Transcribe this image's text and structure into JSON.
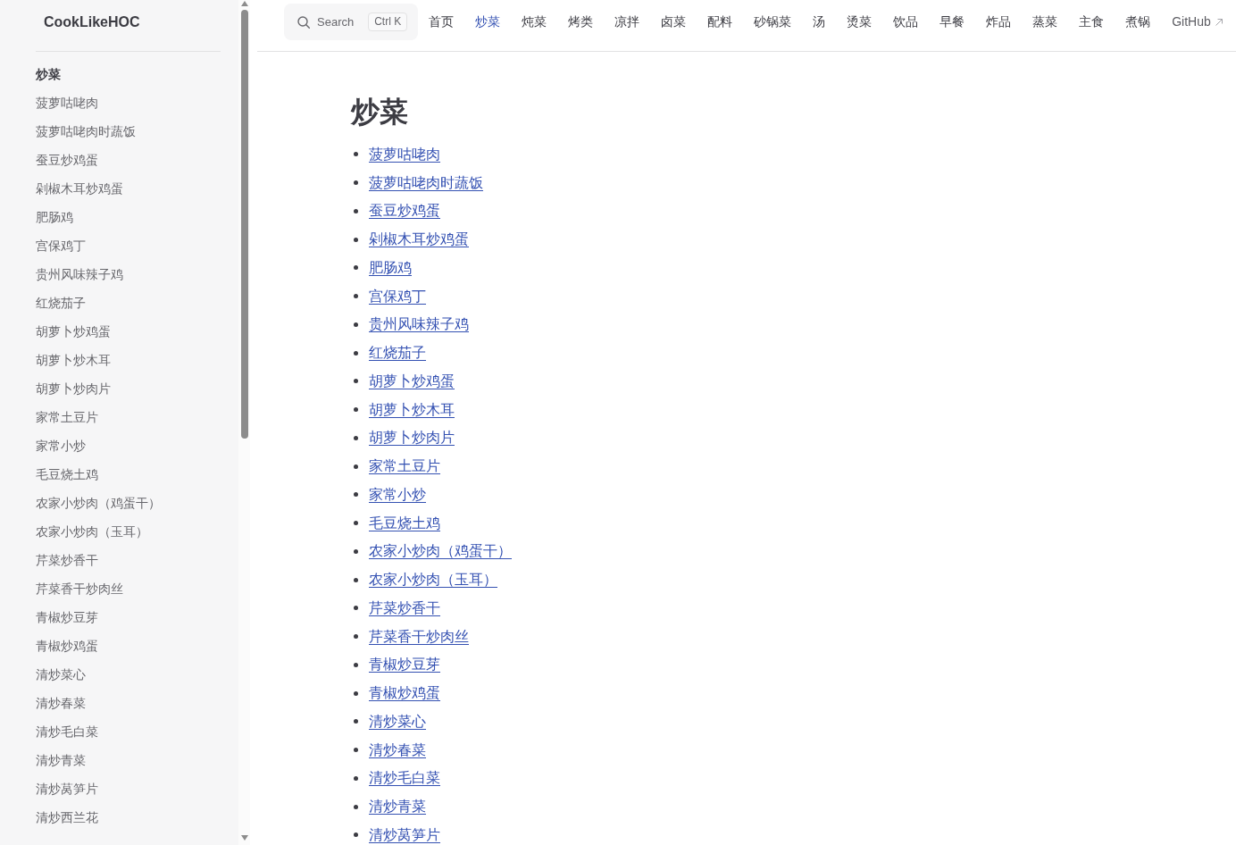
{
  "sidebar": {
    "logo": "CookLikeHOC",
    "group": {
      "title": "炒菜",
      "items": [
        {
          "label": "菠萝咕咾肉",
          "selected": false
        },
        {
          "label": "菠萝咕咾肉时蔬饭",
          "selected": false
        },
        {
          "label": "蚕豆炒鸡蛋",
          "selected": false
        },
        {
          "label": "剁椒木耳炒鸡蛋",
          "selected": false
        },
        {
          "label": "肥肠鸡",
          "selected": false
        },
        {
          "label": "宫保鸡丁",
          "selected": false
        },
        {
          "label": "贵州风味辣子鸡",
          "selected": false
        },
        {
          "label": "红烧茄子",
          "selected": false
        },
        {
          "label": "胡萝卜炒鸡蛋",
          "selected": false
        },
        {
          "label": "胡萝卜炒木耳",
          "selected": false
        },
        {
          "label": "胡萝卜炒肉片",
          "selected": false
        },
        {
          "label": "家常土豆片",
          "selected": false
        },
        {
          "label": "家常小炒",
          "selected": false
        },
        {
          "label": "毛豆烧土鸡",
          "selected": false
        },
        {
          "label": "农家小炒肉（鸡蛋干）",
          "selected": false
        },
        {
          "label": "农家小炒肉（玉耳）",
          "selected": false
        },
        {
          "label": "芹菜炒香干",
          "selected": false
        },
        {
          "label": "芹菜香干炒肉丝",
          "selected": false
        },
        {
          "label": "青椒炒豆芽",
          "selected": false
        },
        {
          "label": "青椒炒鸡蛋",
          "selected": false
        },
        {
          "label": "清炒菜心",
          "selected": false
        },
        {
          "label": "清炒春菜",
          "selected": false
        },
        {
          "label": "清炒毛白菜",
          "selected": false
        },
        {
          "label": "清炒青菜",
          "selected": false
        },
        {
          "label": "清炒莴笋片",
          "selected": false
        },
        {
          "label": "清炒西兰花",
          "selected": false
        }
      ]
    }
  },
  "nav": {
    "search": {
      "label": "Search",
      "shortcut": "Ctrl K"
    },
    "items": [
      {
        "label": "首页",
        "selected": false
      },
      {
        "label": "炒菜",
        "selected": true
      },
      {
        "label": "炖菜",
        "selected": false
      },
      {
        "label": "烤类",
        "selected": false
      },
      {
        "label": "凉拌",
        "selected": false
      },
      {
        "label": "卤菜",
        "selected": false
      },
      {
        "label": "配料",
        "selected": false
      },
      {
        "label": "砂锅菜",
        "selected": false
      },
      {
        "label": "汤",
        "selected": false
      },
      {
        "label": "烫菜",
        "selected": false
      },
      {
        "label": "饮品",
        "selected": false
      },
      {
        "label": "早餐",
        "selected": false
      },
      {
        "label": "炸品",
        "selected": false
      },
      {
        "label": "蒸菜",
        "selected": false
      },
      {
        "label": "主食",
        "selected": false
      },
      {
        "label": "煮锅",
        "selected": false
      }
    ],
    "github_link": {
      "label": "GitHub"
    }
  },
  "article": {
    "title": "炒菜",
    "links": [
      "菠萝咕咾肉",
      "菠萝咕咾肉时蔬饭",
      "蚕豆炒鸡蛋",
      "剁椒木耳炒鸡蛋",
      "肥肠鸡",
      "宫保鸡丁",
      "贵州风味辣子鸡",
      "红烧茄子",
      "胡萝卜炒鸡蛋",
      "胡萝卜炒木耳",
      "胡萝卜炒肉片",
      "家常土豆片",
      "家常小炒",
      "毛豆烧土鸡",
      "农家小炒肉（鸡蛋干）",
      "农家小炒肉（玉耳）",
      "芹菜炒香干",
      "芹菜香干炒肉丝",
      "青椒炒豆芽",
      "青椒炒鸡蛋",
      "清炒菜心",
      "清炒春菜",
      "清炒毛白菜",
      "清炒青菜",
      "清炒莴笋片"
    ]
  }
}
